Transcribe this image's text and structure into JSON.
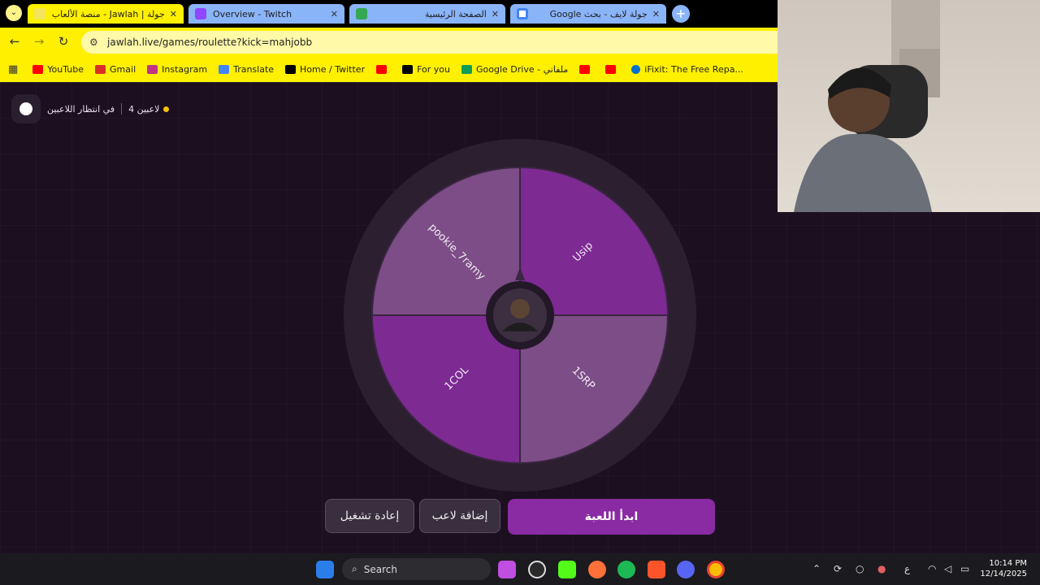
{
  "browser": {
    "tabs": [
      {
        "title": "جولة | Jawlah - منصة الألعاب الت",
        "active": true,
        "icon": "jawlah-icon"
      },
      {
        "title": "Overview - Twitch",
        "active": false,
        "icon": "twitch-icon"
      },
      {
        "title": "الصفحة الرئيسية",
        "active": false,
        "icon": "classroom-icon"
      },
      {
        "title": "جولة لايف - بحث Google",
        "active": false,
        "icon": "google-icon"
      }
    ],
    "url": "jawlah.live/games/roulette?kick=mahjobb",
    "bookmarks": [
      {
        "label": "YouTube",
        "color": "#ff0000"
      },
      {
        "label": "Gmail",
        "color": "#d93025"
      },
      {
        "label": "Instagram",
        "color": "#c13584"
      },
      {
        "label": "Translate",
        "color": "#4285f4"
      },
      {
        "label": "Home / Twitter",
        "color": "#000000"
      },
      {
        "label": "",
        "color": "#ff0000"
      },
      {
        "label": "For you",
        "color": "#000000"
      },
      {
        "label": "Google Drive - ملفاتي",
        "color": "#0f9d58"
      },
      {
        "label": "",
        "color": "#ff0000"
      },
      {
        "label": "",
        "color": "#ff0000"
      },
      {
        "label": "iFixit: The Free Repa...",
        "color": "#0071ce"
      }
    ]
  },
  "status": {
    "waiting": "في انتظار اللاعبين",
    "players": "4 لاعبين"
  },
  "wheel": {
    "segments": [
      {
        "name": "Usip",
        "color": "#7d2a93"
      },
      {
        "name": "1SRP",
        "color": "#7c4d86"
      },
      {
        "name": "1COL",
        "color": "#7d2a93"
      },
      {
        "name": "pookie_7ramy",
        "color": "#7c4d86"
      }
    ]
  },
  "buttons": {
    "restart": "إعادة تشغيل",
    "add_player": "إضافة لاعب",
    "start": "ابدأ اللعبة"
  },
  "taskbar": {
    "search": "Search",
    "time": "10:14 PM",
    "date": "12/14/2025",
    "lang": "ع"
  }
}
